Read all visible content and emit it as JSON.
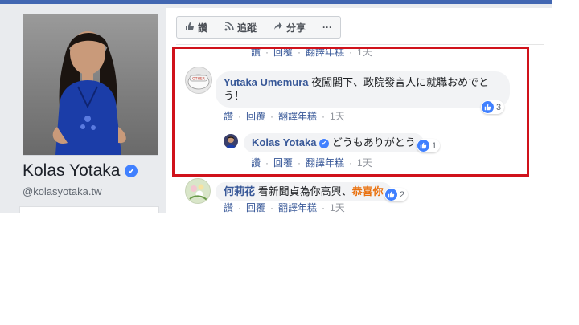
{
  "profile": {
    "name": "Kolas Yotaka",
    "handle": "@kolasyotaka.tw",
    "verified_glyph": "✔"
  },
  "action_bar": {
    "like_label": "讚",
    "follow_label": "追蹤",
    "share_label": "分享",
    "more_label": "···"
  },
  "meta_labels": {
    "like": "讚",
    "reply": "回覆",
    "translate": "翻譯年糕",
    "dot": "·"
  },
  "comments": [
    {
      "time": "1天"
    },
    {
      "author": "Yutaka Umemura",
      "text": "夜闖閣下、政院發言人に就職おめでとう！",
      "reactions": "3",
      "time": "1天",
      "avatar_text": "OTHER"
    },
    {
      "author": "Kolas Yotaka",
      "text": "どうもありがとう",
      "reactions": "1",
      "time": "1天"
    },
    {
      "author": "何莉花",
      "text": "看新聞貞為你高興、",
      "highlight": "恭喜你",
      "reactions": "2",
      "time": "1天"
    }
  ],
  "colors": {
    "facebook_blue": "#4267b2",
    "link_blue": "#385898",
    "highlight_box": "#d0121b",
    "like_blue": "#4080ff",
    "highlight_text": "#e9710f"
  },
  "icons": [
    "like-icon",
    "rss-icon",
    "share-arrow-icon",
    "thumbs-up-icon",
    "verified-check-icon"
  ]
}
